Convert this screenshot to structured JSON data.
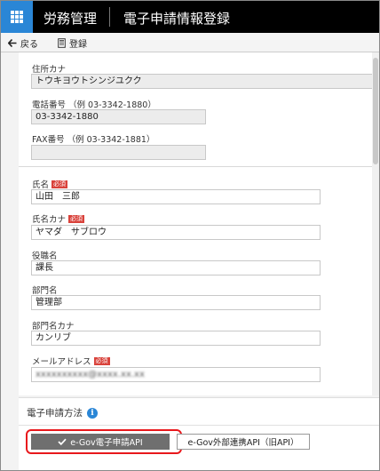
{
  "header": {
    "app_name": "労務管理",
    "page_title": "電子申請情報登録"
  },
  "toolbar": {
    "back_label": "戻る",
    "save_label": "登録"
  },
  "company": {
    "address_kana": {
      "label": "住所カナ",
      "value": "トウキヨウトシンジユクク"
    },
    "phone": {
      "label": "電話番号 （例 03-3342-1880）",
      "value": "03-3342-1880"
    },
    "fax": {
      "label": "FAX番号 （例 03-3342-1881）",
      "value": ""
    }
  },
  "required_badge": "必須",
  "contact": {
    "name": {
      "label": "氏名",
      "value": "山田　三郎",
      "required": true
    },
    "name_kana": {
      "label": "氏名カナ",
      "value": "ヤマダ　サブロウ",
      "required": true
    },
    "title": {
      "label": "役職名",
      "value": "課長"
    },
    "department": {
      "label": "部門名",
      "value": "管理部"
    },
    "department_kana": {
      "label": "部門名カナ",
      "value": "カンリブ"
    },
    "email": {
      "label": "メールアドレス",
      "value": "xxxxxxxxxx@xxxx.xx.xx",
      "required": true
    }
  },
  "method": {
    "title": "電子申請方法",
    "info_icon": "info-icon",
    "options": [
      {
        "label": "e-Gov電子申請API",
        "selected": true,
        "icon": "check-icon"
      },
      {
        "label": "e-Gov外部連携API（旧API）",
        "selected": false
      }
    ]
  },
  "colors": {
    "header_bg": "#000000",
    "app_button": "#2a86d6",
    "required_badge": "#d9423b",
    "selected_option": "#6f6f6f",
    "highlight": "#e8181c"
  }
}
